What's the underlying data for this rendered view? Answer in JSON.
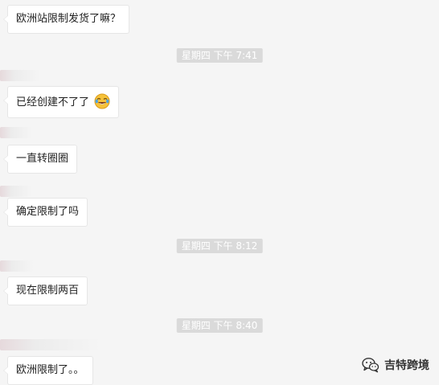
{
  "messages": [
    {
      "text": "欧洲站限制发货了嘛？"
    },
    {
      "text": "已经创建不了了",
      "emoji": "tears-of-joy-emoji"
    },
    {
      "text": "一直转圈圈"
    },
    {
      "text": "确定限制了吗"
    },
    {
      "text": "现在限制两百"
    },
    {
      "text": "欧洲限制了。。"
    }
  ],
  "timestamps": [
    {
      "text": "星期四 下午 7:41"
    },
    {
      "text": "星期四 下午 8:12"
    },
    {
      "text": "星期四 下午 8:40"
    }
  ],
  "watermark": {
    "text": "吉特跨境",
    "icon": "wechat-icon"
  },
  "colors": {
    "background": "#f5f5f5",
    "bubble": "#ffffff",
    "timestamp_bg": "#dadada",
    "timestamp_text": "#ffffff"
  }
}
